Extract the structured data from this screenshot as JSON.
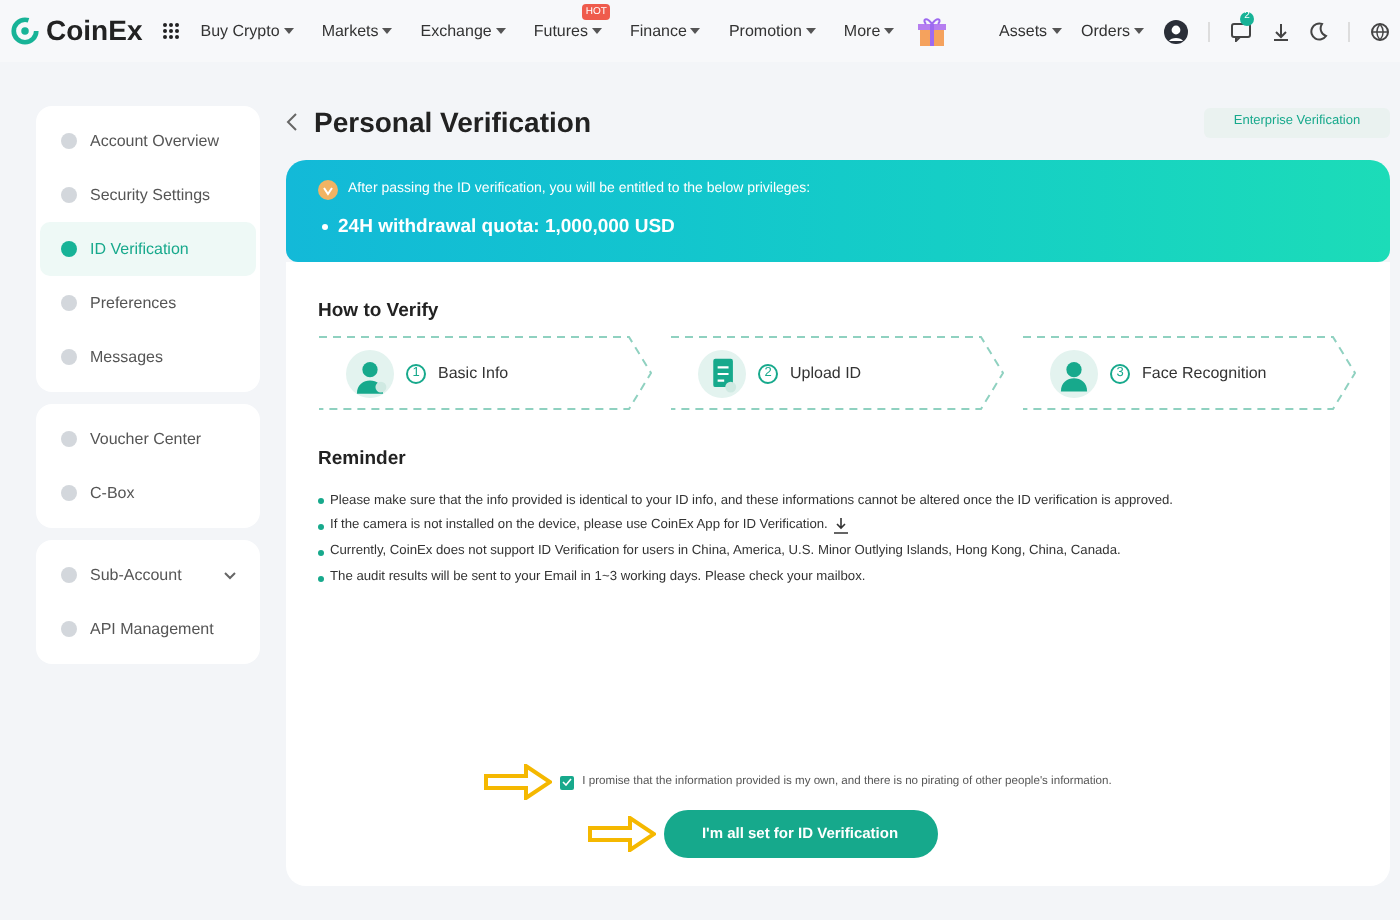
{
  "header": {
    "logo": "CoinEx",
    "nav": [
      {
        "label": "Buy Crypto"
      },
      {
        "label": "Markets"
      },
      {
        "label": "Exchange"
      },
      {
        "label": "Futures",
        "badge": "HOT"
      },
      {
        "label": "Finance"
      },
      {
        "label": "Promotion"
      },
      {
        "label": "More"
      }
    ],
    "right": [
      {
        "label": "Assets"
      },
      {
        "label": "Orders"
      }
    ],
    "notification_count": "2"
  },
  "sidebar": {
    "groups": [
      [
        {
          "label": "Account Overview",
          "selected": false
        },
        {
          "label": "Security Settings",
          "selected": false
        },
        {
          "label": "ID Verification",
          "selected": true
        },
        {
          "label": "Preferences",
          "selected": false
        },
        {
          "label": "Messages",
          "selected": false
        }
      ],
      [
        {
          "label": "Voucher Center",
          "selected": false
        },
        {
          "label": "C-Box",
          "selected": false
        }
      ],
      [
        {
          "label": "Sub-Account",
          "selected": false,
          "expandable": true
        },
        {
          "label": "API Management",
          "selected": false
        }
      ]
    ]
  },
  "page": {
    "title": "Personal Verification",
    "enterprise_button": "Enterprise Verification",
    "banner": {
      "intro": "After passing the ID verification, you will be entitled to the below privileges:",
      "privilege": "24H withdrawal quota: 1,000,000 USD"
    },
    "how_to_verify": {
      "title": "How to Verify",
      "steps": [
        {
          "number": "1",
          "label": "Basic Info",
          "kind": "person"
        },
        {
          "number": "2",
          "label": "Upload ID",
          "kind": "document"
        },
        {
          "number": "3",
          "label": "Face Recognition",
          "kind": "face"
        }
      ]
    },
    "reminder": {
      "title": "Reminder",
      "items": [
        {
          "text": "Please make sure that the info provided is identical to your ID info, and these informations cannot be altered once the ID verification is approved.",
          "kind": "plain"
        },
        {
          "text": "If the camera is not installed on the device, please use CoinEx App for ID Verification.",
          "kind": "download"
        },
        {
          "text": "Currently, CoinEx does not support ID Verification for users in China, America, U.S. Minor Outlying Islands, Hong Kong, China, Canada.",
          "kind": "plain"
        },
        {
          "text": "The audit results will be sent to your Email in 1~3 working days. Please check your mailbox.",
          "kind": "plain"
        }
      ]
    },
    "promise": {
      "text": "I promise that the information provided is my own, and there is no pirating of other people's information.",
      "checked": true
    },
    "submit": "I'm all set for ID Verification"
  }
}
